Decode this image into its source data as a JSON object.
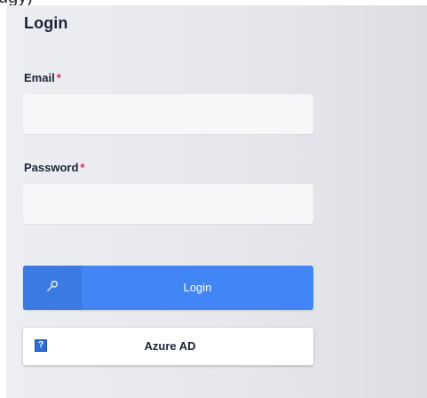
{
  "clipped_top_text": "ugy)",
  "form": {
    "title": "Login",
    "email": {
      "label": "Email",
      "required_marker": "*",
      "value": "",
      "placeholder": ""
    },
    "password": {
      "label": "Password",
      "required_marker": "*",
      "value": "",
      "placeholder": ""
    },
    "login_button": {
      "label": "Login",
      "icon": "key-icon"
    },
    "azure_button": {
      "label": "Azure AD",
      "icon": "broken-image-icon"
    }
  },
  "colors": {
    "primary": "#4285f4",
    "primary_dark": "#3b79e3",
    "required": "#e0245e",
    "text": "#1b2436"
  }
}
